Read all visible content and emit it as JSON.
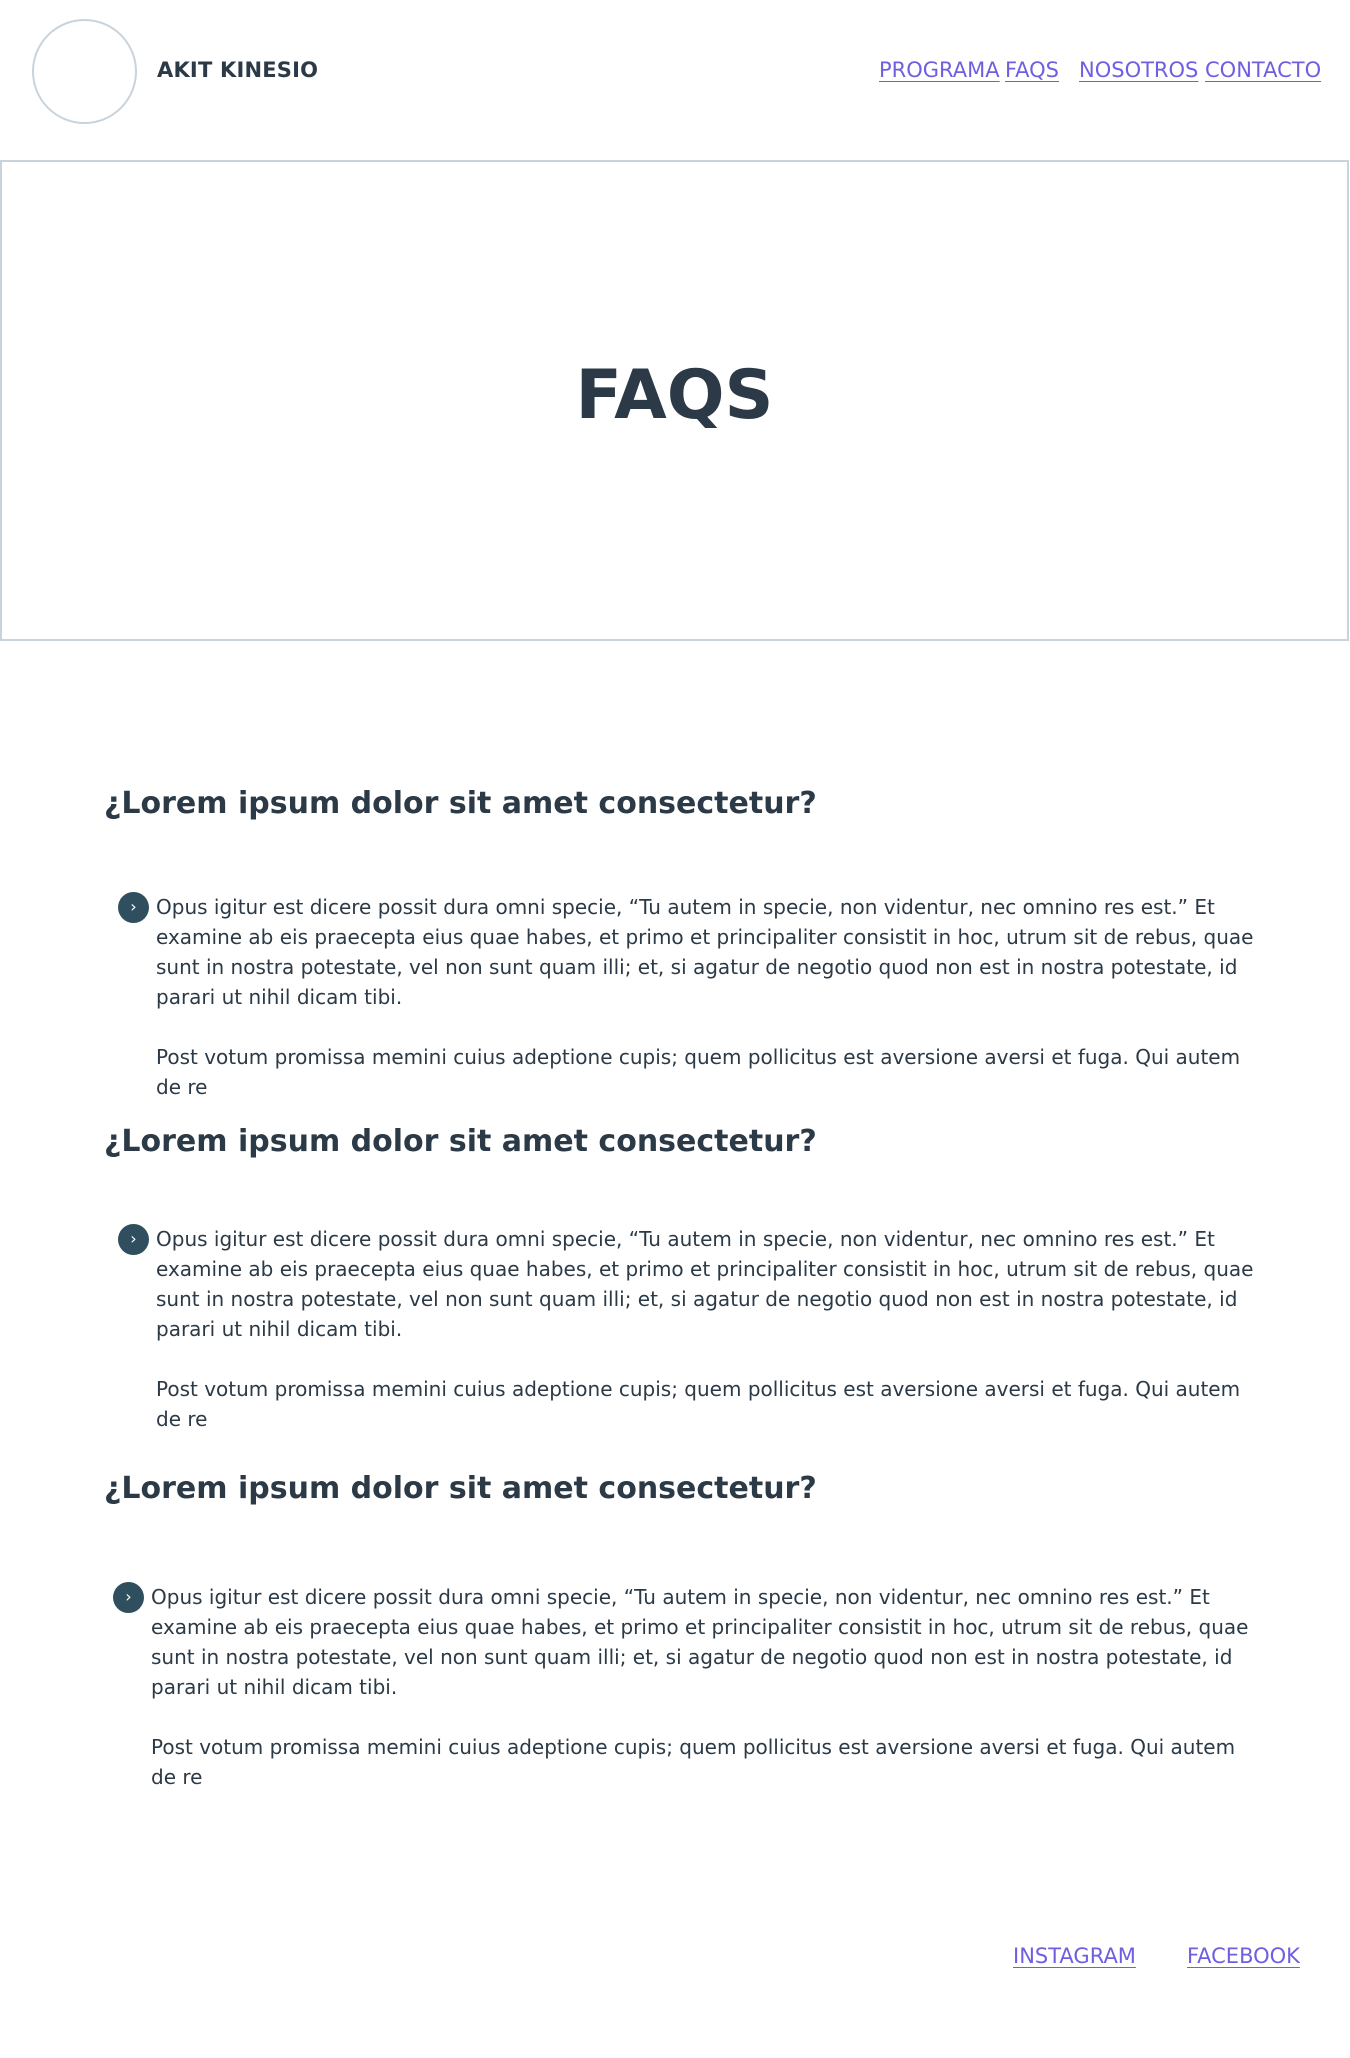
{
  "header": {
    "brand": "AKIT KINESIO",
    "nav": [
      {
        "label": "PROGRAMA"
      },
      {
        "label": "FAQS"
      },
      {
        "label": "NOSOTROS"
      },
      {
        "label": "CONTACTO"
      }
    ]
  },
  "hero": {
    "title": "FAQS"
  },
  "faqs": [
    {
      "question": "¿Lorem ipsum dolor sit amet consectetur?",
      "paragraph1": "Opus igitur est dicere possit dura omni specie, “Tu autem in specie, non videntur, nec omnino res est.” Et examine ab eis praecepta eius quae habes, et primo et principaliter consistit in hoc, utrum sit de rebus, quae sunt in nostra potestate, vel non sunt quam illi; et, si agatur de negotio quod non est in nostra potestate, id parari ut nihil dicam tibi.",
      "paragraph2": "Post votum promissa memini cuius adeptione cupis; quem pollicitus est aversione aversi et fuga. Qui autem de re"
    },
    {
      "question": "¿Lorem ipsum dolor sit amet consectetur?",
      "paragraph1": "Opus igitur est dicere possit dura omni specie, “Tu autem in specie, non videntur, nec omnino res est.” Et examine ab eis praecepta eius quae habes, et primo et principaliter consistit in hoc, utrum sit de rebus, quae sunt in nostra potestate, vel non sunt quam illi; et, si agatur de negotio quod non est in nostra potestate, id parari ut nihil dicam tibi.",
      "paragraph2": "Post votum promissa memini cuius adeptione cupis; quem pollicitus est aversione aversi et fuga. Qui autem de re"
    },
    {
      "question": "¿Lorem ipsum dolor sit amet consectetur?",
      "paragraph1": "Opus igitur est dicere possit dura omni specie, “Tu autem in specie, non videntur, nec omnino res est.” Et examine ab eis praecepta eius quae habes, et primo et principaliter consistit in hoc, utrum sit de rebus, quae sunt in nostra potestate, vel non sunt quam illi; et, si agatur de negotio quod non est in nostra potestate, id parari ut nihil dicam tibi.",
      "paragraph2": "Post votum promissa memini cuius adeptione cupis; quem pollicitus est aversione aversi et fuga. Qui autem de re"
    }
  ],
  "footer": {
    "links": [
      {
        "label": "INSTAGRAM"
      },
      {
        "label": "FACEBOOK"
      }
    ]
  },
  "icons": {
    "logo": "logo-placeholder-circle",
    "bullet": "chevron-right-icon"
  },
  "colors": {
    "text": "#2b3a46",
    "link": "#6f5fe0",
    "bullet": "#2f4f5e",
    "border": "#c8d3dc"
  }
}
